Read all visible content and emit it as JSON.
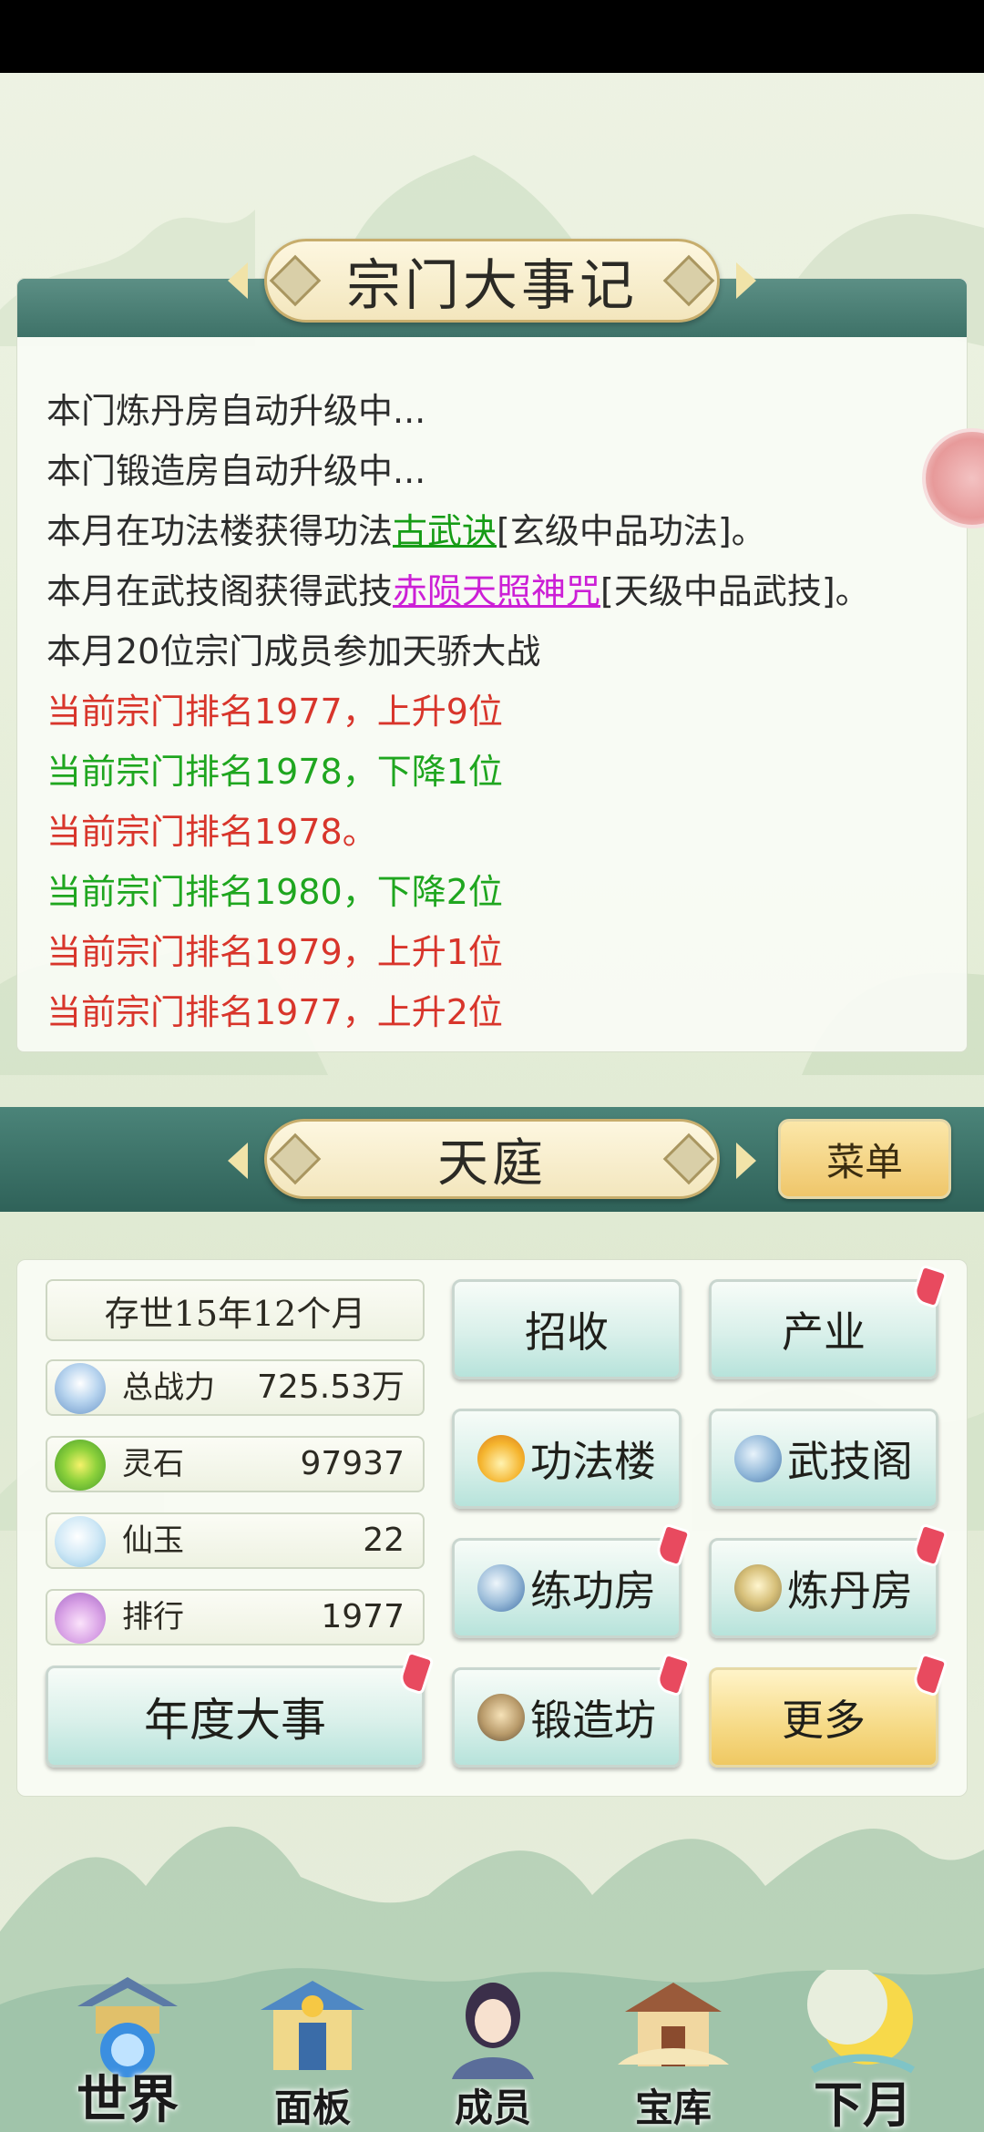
{
  "log": {
    "title": "宗门大事记",
    "entries": [
      {
        "tone": "normal",
        "parts": [
          {
            "text": "本门炼丹房自动升级中..."
          }
        ]
      },
      {
        "tone": "normal",
        "parts": [
          {
            "text": "本门锻造房自动升级中..."
          }
        ]
      },
      {
        "tone": "normal",
        "parts": [
          {
            "text": "本月在功法楼获得功法"
          },
          {
            "text": "古武诀",
            "link": "green"
          },
          {
            "text": "[玄级中品功法]。"
          }
        ]
      },
      {
        "tone": "normal",
        "parts": [
          {
            "text": "本月在武技阁获得武技"
          },
          {
            "text": "赤陨天照神咒",
            "link": "purple"
          },
          {
            "text": "[天级中品武技]。"
          }
        ]
      },
      {
        "tone": "normal",
        "parts": [
          {
            "text": "本月20位宗门成员参加天骄大战"
          }
        ]
      },
      {
        "tone": "red",
        "parts": [
          {
            "text": "当前宗门排名1977，上升9位"
          }
        ]
      },
      {
        "tone": "green",
        "parts": [
          {
            "text": "当前宗门排名1978，下降1位"
          }
        ]
      },
      {
        "tone": "red",
        "parts": [
          {
            "text": "当前宗门排名1978。"
          }
        ]
      },
      {
        "tone": "green",
        "parts": [
          {
            "text": "当前宗门排名1980，下降2位"
          }
        ]
      },
      {
        "tone": "red",
        "parts": [
          {
            "text": "当前宗门排名1979，上升1位"
          }
        ]
      },
      {
        "tone": "red",
        "parts": [
          {
            "text": "当前宗门排名1977，上升2位"
          }
        ]
      }
    ]
  },
  "section": {
    "title": "天庭",
    "menu_label": "菜单"
  },
  "stats": {
    "age": "存世15年12个月",
    "power": {
      "label": "总战力",
      "value": "725.53万",
      "icon": "power-icon"
    },
    "spirit_stone": {
      "label": "灵石",
      "value": "97937",
      "icon": "spirit-stone-icon"
    },
    "jade": {
      "label": "仙玉",
      "value": "22",
      "icon": "jade-icon"
    },
    "rank": {
      "label": "排行",
      "value": "1977",
      "icon": "lotus-icon"
    }
  },
  "buttons": {
    "yearly": "年度大事",
    "recruit": "招收",
    "industry": "产业",
    "gongfa": "功法楼",
    "wuji": "武技阁",
    "training": "练功房",
    "alchemy": "炼丹房",
    "forge": "锻造坊",
    "more": "更多"
  },
  "nav": {
    "world": "世界",
    "panel": "面板",
    "members": "成员",
    "treasury": "宝库",
    "next_month": "下月"
  },
  "colors": {
    "red": "#d8352b",
    "green": "#1fa61f",
    "link_green": "#169c16",
    "link_purple": "#cc20d6",
    "teal_band": "#3e7268",
    "badge": "#e84a5f"
  }
}
